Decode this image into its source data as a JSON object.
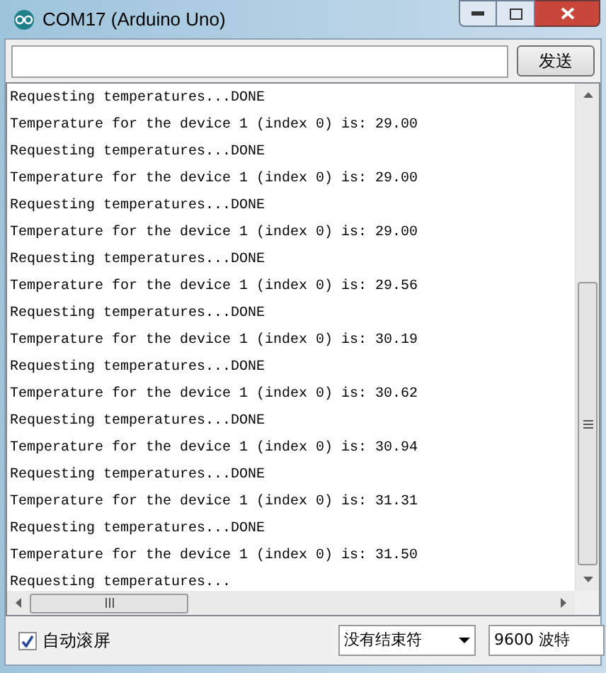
{
  "window": {
    "title": "COM17 (Arduino Uno)"
  },
  "send_button": "发送",
  "output_lines": [
    "Requesting temperatures...DONE",
    "Temperature for the device 1 (index 0) is: 29.00",
    "Requesting temperatures...DONE",
    "Temperature for the device 1 (index 0) is: 29.00",
    "Requesting temperatures...DONE",
    "Temperature for the device 1 (index 0) is: 29.00",
    "Requesting temperatures...DONE",
    "Temperature for the device 1 (index 0) is: 29.56",
    "Requesting temperatures...DONE",
    "Temperature for the device 1 (index 0) is: 30.19",
    "Requesting temperatures...DONE",
    "Temperature for the device 1 (index 0) is: 30.62",
    "Requesting temperatures...DONE",
    "Temperature for the device 1 (index 0) is: 30.94",
    "Requesting temperatures...DONE",
    "Temperature for the device 1 (index 0) is: 31.31",
    "Requesting temperatures...DONE",
    "Temperature for the device 1 (index 0) is: 31.50",
    "Requesting temperatures..."
  ],
  "autoscroll": {
    "label": "自动滚屏",
    "checked": true
  },
  "line_ending": "没有结束符",
  "baud_rate": "9600 波特"
}
